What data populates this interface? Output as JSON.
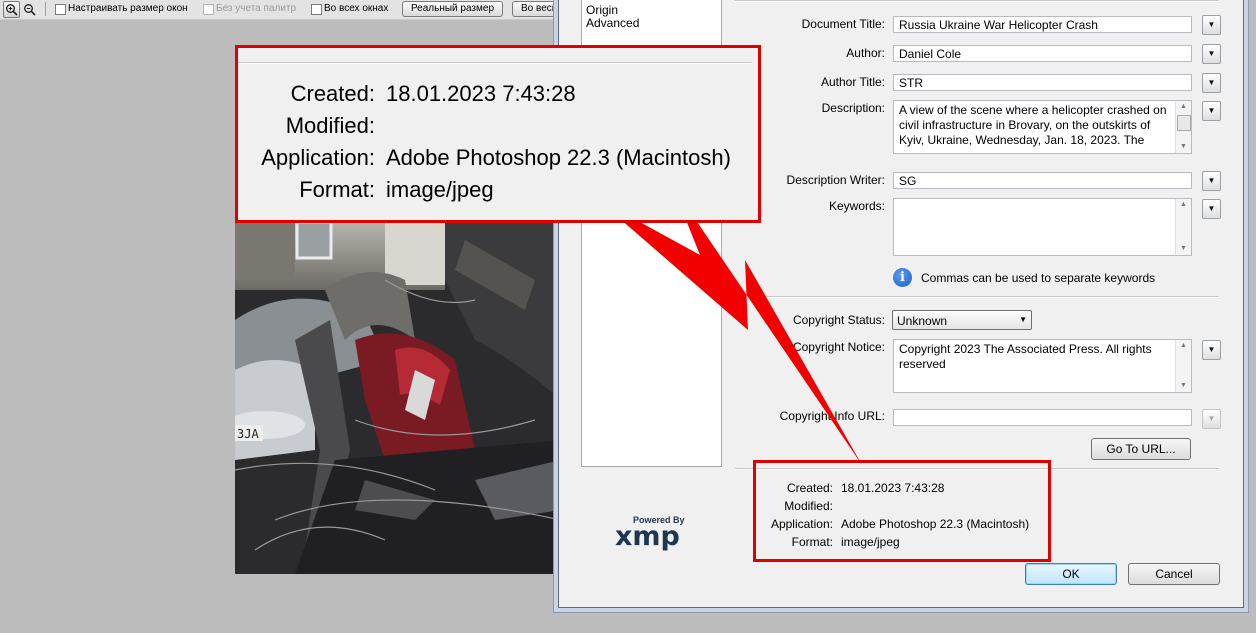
{
  "toolbar": {
    "resize_windows_label": "Настраивать размер окон",
    "ignore_palettes_label": "Без учета палитр",
    "all_windows_label": "Во всех окнах",
    "actual_size_button": "Реальный размер",
    "fit_button": "Во весь"
  },
  "sidebar": {
    "items": [
      {
        "label": "Origin"
      },
      {
        "label": "Advanced"
      }
    ]
  },
  "form": {
    "document_title": {
      "label": "Document Title:",
      "value": "Russia Ukraine War Helicopter Crash"
    },
    "author": {
      "label": "Author:",
      "value": "Daniel Cole"
    },
    "author_title": {
      "label": "Author Title:",
      "value": "STR"
    },
    "description": {
      "label": "Description:",
      "value": "A view of the scene where a helicopter crashed on civil infrastructure in Brovary, on the outskirts of Kyiv, Ukraine, Wednesday, Jan. 18, 2023. The"
    },
    "description_writer": {
      "label": "Description Writer:",
      "value": "SG"
    },
    "keywords": {
      "label": "Keywords:",
      "value": ""
    },
    "keywords_hint": "Commas can be used to separate keywords",
    "copyright_status": {
      "label": "Copyright Status:",
      "value": "Unknown"
    },
    "copyright_notice": {
      "label": "Copyright Notice:",
      "value": "Copyright 2023 The Associated Press. All rights reserved"
    },
    "copyright_info_url": {
      "label": "Copyright Info URL:",
      "value": ""
    },
    "go_to_url": "Go To URL..."
  },
  "file_info": {
    "created_label": "Created:",
    "created": "18.01.2023 7:43:28",
    "modified_label": "Modified:",
    "modified": "",
    "application_label": "Application:",
    "application": "Adobe Photoshop 22.3 (Macintosh)",
    "format_label": "Format:",
    "format": "image/jpeg"
  },
  "logo": {
    "powered_by": "Powered By",
    "name": "xmp"
  },
  "buttons": {
    "ok": "OK",
    "cancel": "Cancel"
  },
  "colors": {
    "highlight_red": "#e00000",
    "info_icon_blue": "#1c5fc9"
  }
}
